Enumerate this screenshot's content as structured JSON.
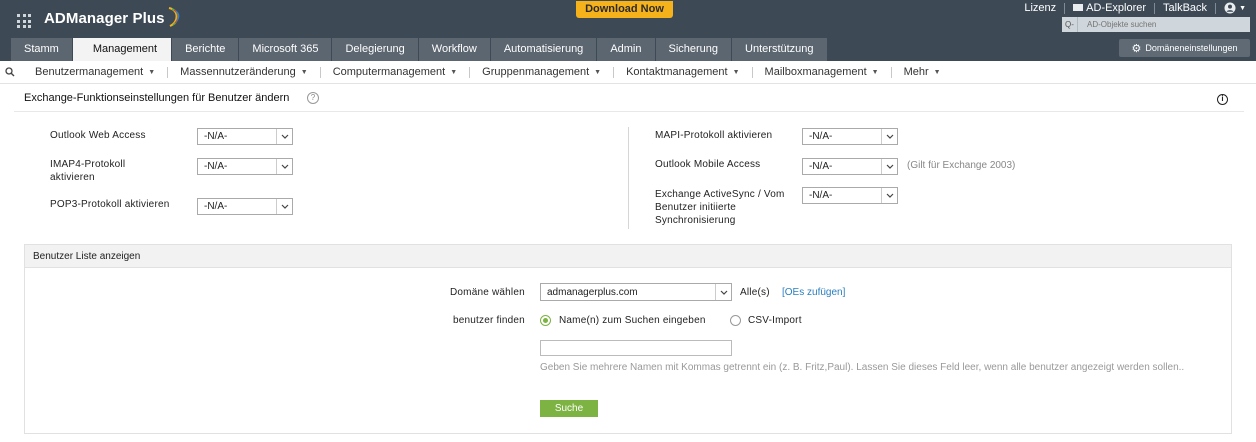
{
  "header": {
    "brand": "ADManager Plus",
    "download_label": "Download Now",
    "links": [
      "Lizenz",
      "AD-Explorer",
      "TalkBack"
    ],
    "search_placeholder": "AD-Objekte suchen",
    "domain_settings_label": "Domäneneinstellungen"
  },
  "tabs": [
    "Stamm",
    "Management",
    "Berichte",
    "Microsoft 365",
    "Delegierung",
    "Workflow",
    "Automatisierung",
    "Admin",
    "Sicherung",
    "Unterstützung"
  ],
  "active_tab": "Management",
  "subnav": [
    "Benutzermanagement",
    "Massennutzeränderung",
    "Computermanagement",
    "Gruppenmanagement",
    "Kontaktmanagement",
    "Mailboxmanagement",
    "Mehr"
  ],
  "page": {
    "title": "Exchange-Funktionseinstellungen für Benutzer ändern"
  },
  "form": {
    "left": [
      {
        "label": "Outlook Web Access",
        "value": "-N/A-"
      },
      {
        "label": "IMAP4-Protokoll aktivieren",
        "value": "-N/A-"
      },
      {
        "label": "POP3-Protokoll aktivieren",
        "value": "-N/A-"
      }
    ],
    "right": [
      {
        "label": "MAPI-Protokoll aktivieren",
        "value": "-N/A-"
      },
      {
        "label": "Outlook Mobile Access",
        "value": "-N/A-",
        "note": "(Gilt für Exchange 2003)"
      },
      {
        "label": "Exchange ActiveSync / Vom Benutzer initiierte Synchronisierung",
        "value": "-N/A-"
      }
    ]
  },
  "user_list": {
    "heading": "Benutzer Liste anzeigen",
    "domain_label": "Domäne wählen",
    "domain_value": "admanagerplus.com",
    "scope_label": "Alle(s)",
    "add_ous_link": "[OEs zufügen]",
    "find_label": "benutzer finden",
    "radio_names": "Name(n) zum Suchen eingeben",
    "radio_csv": "CSV-Import",
    "hint": "Geben Sie mehrere Namen mit Kommas getrennt ein (z. B. Fritz,Paul). Lassen Sie dieses Feld leer, wenn alle benutzer angezeigt werden sollen..",
    "search_button": "Suche"
  }
}
